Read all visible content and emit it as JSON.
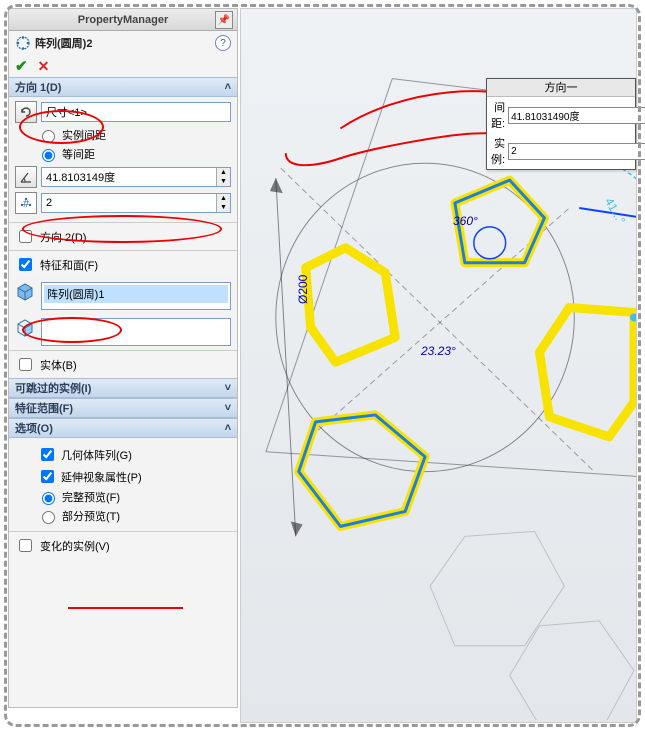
{
  "pm": {
    "title": "PropertyManager",
    "feature_name": "阵列(圆周)2",
    "ok_glyph": "✔",
    "cancel_glyph": "✕",
    "help_glyph": "?",
    "pin_glyph": "📌"
  },
  "dir1": {
    "title": "方向 1(D)",
    "ref": "尺寸<1>",
    "opt_spacing": "实例间距",
    "opt_equal": "等间距",
    "angle": "41.8103149度",
    "instances": "2"
  },
  "dir2": {
    "label": "方向 2(D)"
  },
  "features": {
    "title": "特征和面(F)",
    "item": "阵列(圆周)1"
  },
  "bodies": {
    "label": "实体(B)"
  },
  "skippable": {
    "title": "可跳过的实例(I)"
  },
  "scope": {
    "title": "特征范围(F)"
  },
  "options": {
    "title": "选项(O)",
    "geom": "几何体阵列(G)",
    "propvis": "延伸视象属性(P)",
    "full_preview": "完整预览(F)",
    "partial_preview": "部分预览(T)"
  },
  "varied": {
    "label": "变化的实例(V)"
  },
  "floater": {
    "title": "方向一",
    "spacing_label": "间距:",
    "spacing_value": "41.81031490度",
    "inst_label": "实例:",
    "inst_value": "2"
  },
  "chart_data": {
    "type": "table",
    "parameters": [
      {
        "name": "间距 (spacing / angle)",
        "value": 41.8103149,
        "unit": "度",
        "source": "尺寸<1>"
      },
      {
        "name": "实例 (instances)",
        "value": 2
      }
    ]
  },
  "dims": {
    "diam": "Ø200",
    "ang_360": "360°",
    "ang_23": "23.23°",
    "ang_41": "41...°"
  }
}
